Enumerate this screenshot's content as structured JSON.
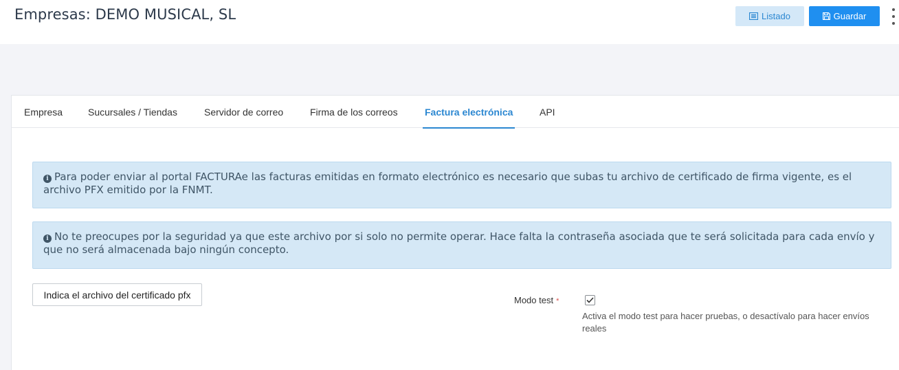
{
  "header": {
    "title": "Empresas: DEMO MUSICAL, SL",
    "listado_label": "Listado",
    "guardar_label": "Guardar"
  },
  "tabs": [
    {
      "label": "Empresa",
      "active": false
    },
    {
      "label": "Sucursales / Tiendas",
      "active": false
    },
    {
      "label": "Servidor de correo",
      "active": false
    },
    {
      "label": "Firma de los correos",
      "active": false
    },
    {
      "label": "Factura electrónica",
      "active": true
    },
    {
      "label": "API",
      "active": false
    }
  ],
  "alerts": [
    {
      "text": "Para poder enviar al portal FACTURAe las facturas emitidas en formato electrónico es necesario que subas tu archivo de certificado de firma vigente, es el archivo PFX emitido por la FNMT."
    },
    {
      "text": "No te preocupes por la seguridad ya que este archivo por si solo no permite operar. Hace falta la contraseña asociada que te será solicitada para cada envío y que no será almacenada bajo ningún concepto."
    }
  ],
  "form": {
    "file_button_label": "Indica el archivo del certificado pfx",
    "modo_test_label": "Modo test",
    "required_mark": "*",
    "modo_test_checked": true,
    "modo_test_help": "Activa el modo test para hacer pruebas, o desactívalo para hacer envíos reales"
  },
  "colors": {
    "accent": "#2b87d1",
    "primary_button": "#1f8ff0",
    "alert_bg": "#d5e8f6"
  }
}
